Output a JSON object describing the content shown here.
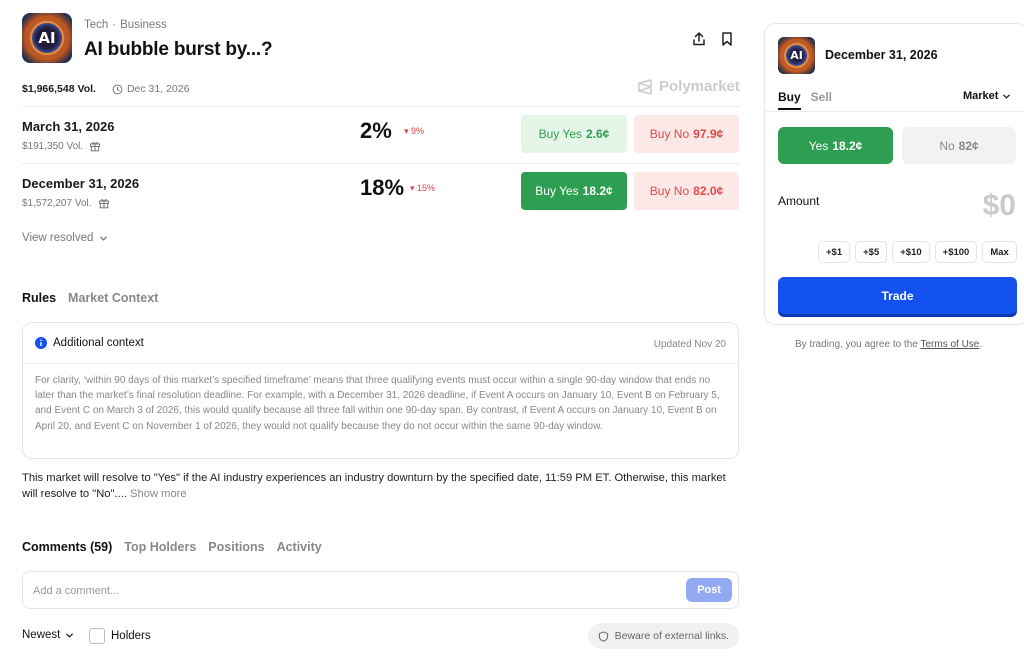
{
  "header": {
    "logo_text": "AI",
    "categories": [
      "Tech",
      "Business"
    ],
    "title": "AI bubble burst by...?",
    "volume": "$1,966,548 Vol.",
    "end_date": "Dec 31, 2026",
    "brand": "Polymarket"
  },
  "markets": [
    {
      "date": "March 31, 2026",
      "volume": "$191,350 Vol.",
      "percent": "2%",
      "change": "9%",
      "yes_label": "Buy Yes",
      "yes_price": "2.6¢",
      "no_label": "Buy No",
      "no_price": "97.9¢"
    },
    {
      "date": "December 31, 2026",
      "volume": "$1,572,207 Vol.",
      "percent": "18%",
      "change": "15%",
      "yes_label": "Buy Yes",
      "yes_price": "18.2¢",
      "no_label": "Buy No",
      "no_price": "82.0¢"
    }
  ],
  "view_resolved": "View resolved",
  "rules_tabs": [
    "Rules",
    "Market Context"
  ],
  "context": {
    "heading": "Additional context",
    "updated": "Updated Nov 20",
    "body": "For clarity, ‘within 90 days of this market’s specified timeframe’ means that three qualifying events must occur within a single 90-day window that ends no later than the market’s final resolution deadline. For example, with a December 31, 2026 deadline, if Event A occurs on January 10, Event B on February 5, and Event C on March 3 of 2026, this would qualify because all three fall within one 90-day span. By contrast, if Event A occurs on January 10, Event B on April 20, and Event C on November 1 of 2026, they would not qualify because they do not occur within the same 90-day window."
  },
  "resolution": {
    "text": "This market will resolve to \"Yes\" if the AI industry experiences an industry downturn by the specified date, 11:59 PM ET. Otherwise, this market will resolve to \"No\"....",
    "show_more": "Show more"
  },
  "bottom_tabs": [
    "Comments (59)",
    "Top Holders",
    "Positions",
    "Activity"
  ],
  "comment": {
    "placeholder": "Add a comment...",
    "post_label": "Post"
  },
  "filters": {
    "sort": "Newest",
    "holders_label": "Holders",
    "beware": "Beware of external links."
  },
  "panel": {
    "logo_text": "AI",
    "title": "December 31, 2026",
    "tabs": [
      "Buy",
      "Sell"
    ],
    "order_type": "Market",
    "yes_label": "Yes",
    "yes_price": "18.2¢",
    "no_label": "No",
    "no_price": "82¢",
    "amount_label": "Amount",
    "amount_value": "$0",
    "chips": [
      "+$1",
      "+$5",
      "+$10",
      "+$100",
      "Max"
    ],
    "trade_label": "Trade",
    "terms_prefix": "By trading, you agree to the",
    "terms_link": "Terms of Use",
    "terms_suffix": "."
  },
  "colors": {
    "green": "#2e9e52",
    "green_light": "#e5f6e9",
    "red": "#e04848",
    "red_light": "#fde8e8",
    "blue": "#1452f0"
  }
}
